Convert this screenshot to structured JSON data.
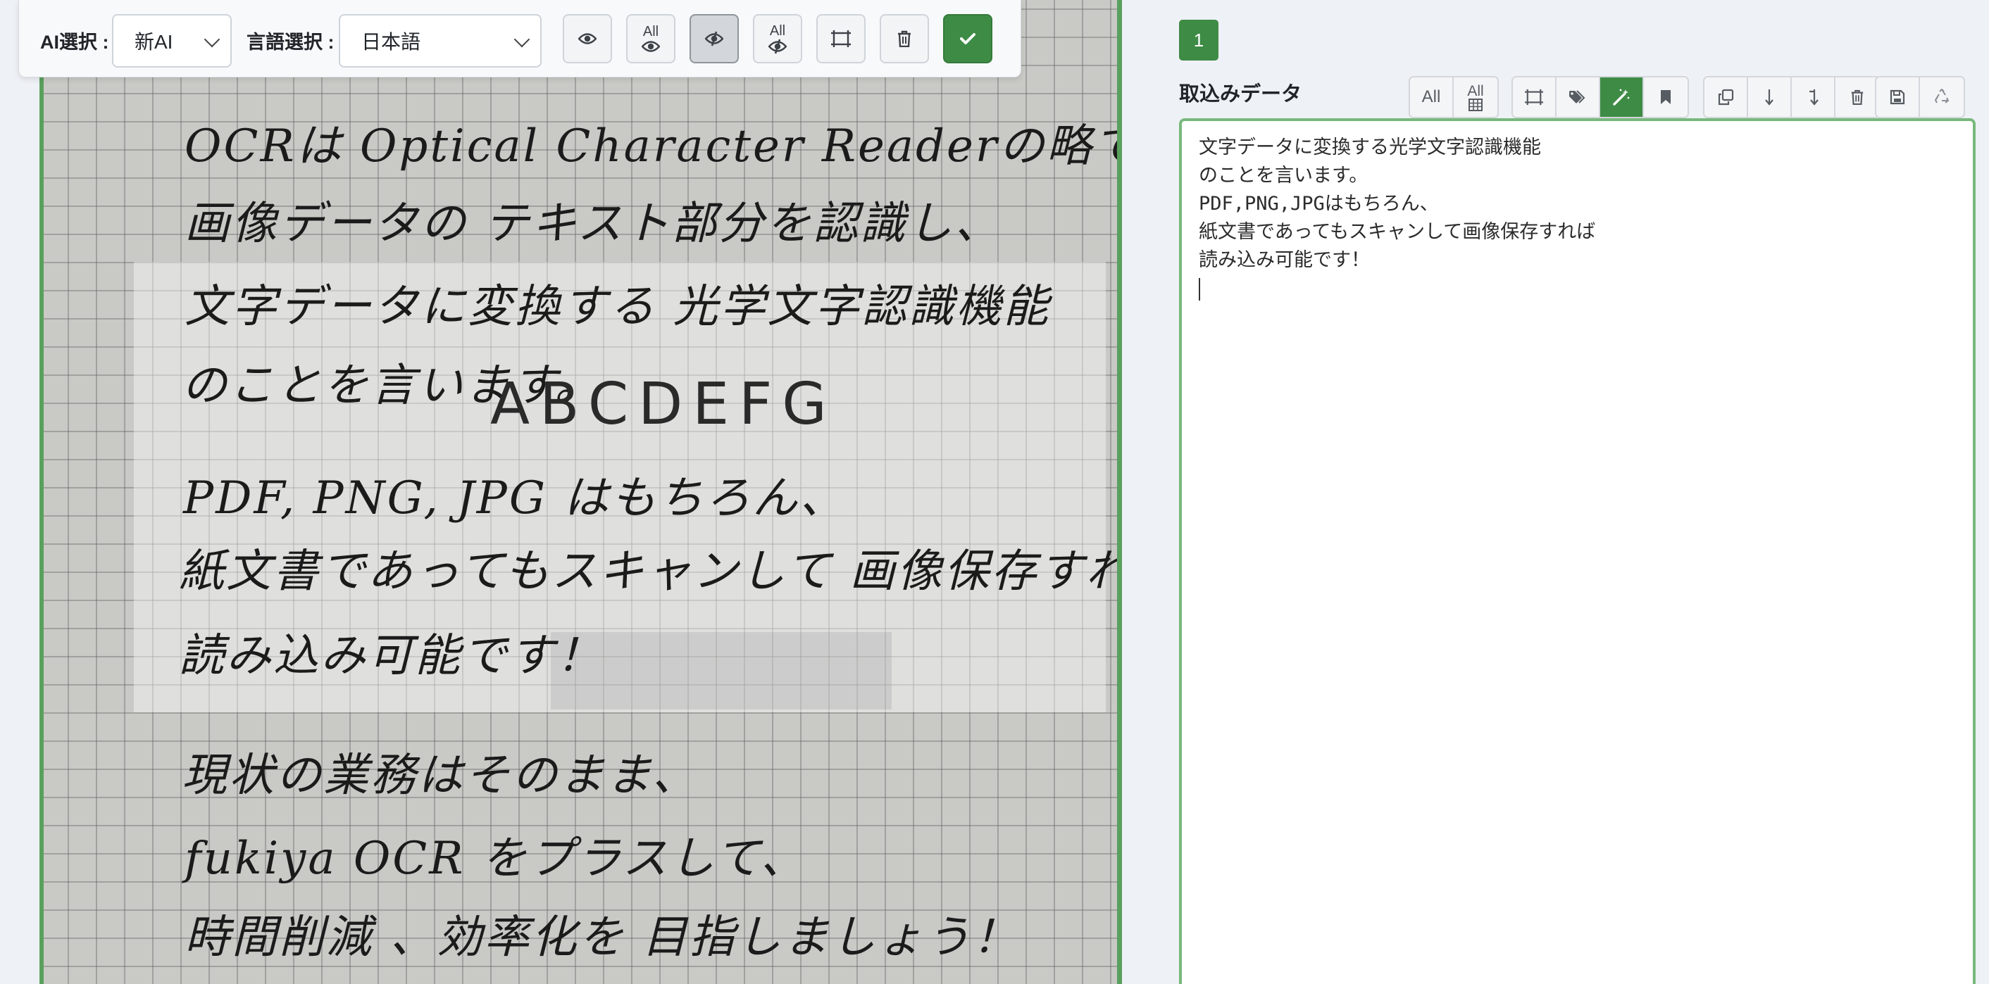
{
  "toolbar": {
    "ai_label": "AI選択 :",
    "ai_selected": "新AI",
    "lang_label": "言語選択 :",
    "lang_selected": "日本語",
    "all_label": "All"
  },
  "image": {
    "handwritten_lines": [
      "OCRは Optical Character Readerの略で、",
      "画像データの テキスト部分を認識し、",
      "文字データに変換する 光学文字認識機能",
      "のことを言います。",
      "ABCDEFG",
      "PDF, PNG, JPG はもちろん、",
      "紙文書であってもスキャンして 画像保存すれば",
      "読み込み可能です！",
      "現状の業務はそのまま、",
      "fukiya OCR をプラスして、",
      "時間削減 、効率化を 目指しましょう！"
    ]
  },
  "panel": {
    "page_number": "1",
    "title": "取込みデータ",
    "all_label": "All",
    "all_table_label": "All",
    "text_lines": [
      "文字データに変換する光学文字認識機能",
      "のことを言います。",
      "PDF,PNG,JPGはもちろん、",
      "紙文書であってもスキャンして画像保存すれば",
      "読み込み可能です！"
    ]
  },
  "colors": {
    "accent_green": "#3e8b45",
    "frame_green": "#5aa05d",
    "editor_border": "#78b87c"
  }
}
